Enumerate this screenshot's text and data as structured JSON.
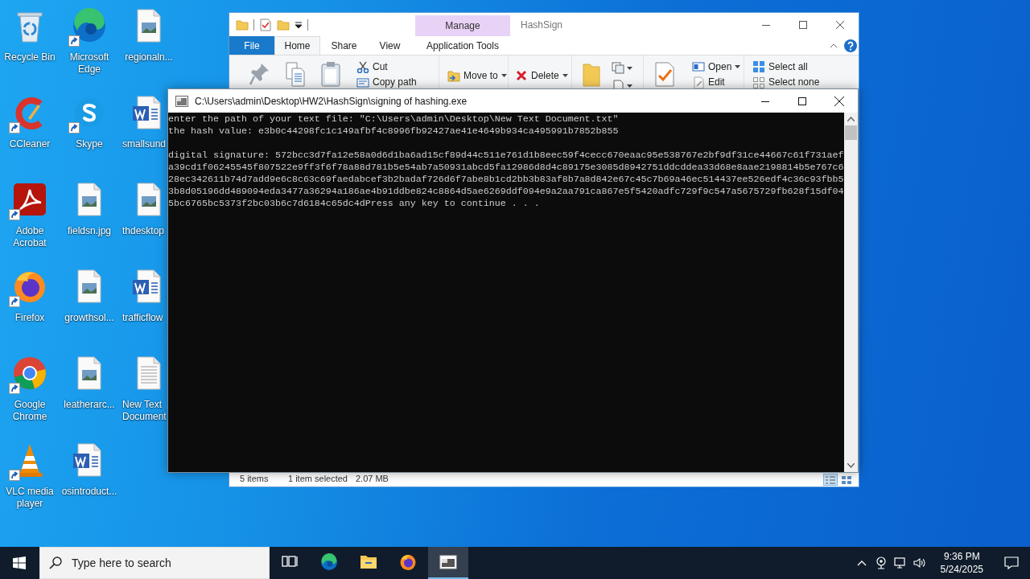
{
  "desktop_icons": [
    {
      "label": "Recycle Bin",
      "kind": "recycle",
      "shortcut": false,
      "cut": false
    },
    {
      "label": "CCleaner",
      "kind": "ccleaner",
      "shortcut": true,
      "cut": false
    },
    {
      "label": "Adobe Acrobat",
      "kind": "acrobat",
      "shortcut": true,
      "cut": false
    },
    {
      "label": "Firefox",
      "kind": "firefox",
      "shortcut": true,
      "cut": false
    },
    {
      "label": "Google Chrome",
      "kind": "chrome",
      "shortcut": true,
      "cut": false
    },
    {
      "label": "VLC media player",
      "kind": "vlc",
      "shortcut": true,
      "cut": false
    },
    {
      "label": "Microsoft Edge",
      "kind": "edge",
      "shortcut": true,
      "cut": false
    },
    {
      "label": "Skype",
      "kind": "skype",
      "shortcut": true,
      "cut": false
    },
    {
      "label": "fieldsn.jpg",
      "kind": "image",
      "shortcut": false,
      "cut": false
    },
    {
      "label": "growthsol...",
      "kind": "image",
      "shortcut": false,
      "cut": false
    },
    {
      "label": "leatherarc...",
      "kind": "image",
      "shortcut": false,
      "cut": false
    },
    {
      "label": "osintroduct...",
      "kind": "word",
      "shortcut": false,
      "cut": false
    },
    {
      "label": "regionaln...",
      "kind": "image",
      "shortcut": false,
      "cut": false
    },
    {
      "label": "smallsund",
      "kind": "word",
      "shortcut": false,
      "cut": true
    },
    {
      "label": "thdesktop",
      "kind": "image",
      "shortcut": false,
      "cut": true
    },
    {
      "label": "trafficflow",
      "kind": "word",
      "shortcut": false,
      "cut": true
    },
    {
      "label": "New Text Document",
      "kind": "text",
      "shortcut": false,
      "cut": true
    }
  ],
  "explorer": {
    "title": "HashSign",
    "context_group": "Manage",
    "tabs": [
      {
        "label": "File",
        "kind": "file",
        "selected": false
      },
      {
        "label": "Home",
        "kind": "tab",
        "selected": true
      },
      {
        "label": "Share",
        "kind": "tab",
        "selected": false
      },
      {
        "label": "View",
        "kind": "tab",
        "selected": false
      },
      {
        "label": "Application Tools",
        "kind": "context",
        "selected": false
      }
    ],
    "ribbon": [
      {
        "label": "Cut",
        "kind": "cut",
        "dropdown": false
      },
      {
        "label": "Copy path",
        "kind": "copy-path",
        "dropdown": false
      },
      {
        "label": "Move to",
        "kind": "move-to",
        "dropdown": true
      },
      {
        "label": "Delete",
        "kind": "delete",
        "dropdown": true
      },
      {
        "label": "Open",
        "kind": "open",
        "dropdown": true
      },
      {
        "label": "Edit",
        "kind": "edit",
        "dropdown": false
      },
      {
        "label": "Select all",
        "kind": "select-all",
        "dropdown": false
      },
      {
        "label": "Select none",
        "kind": "select-none",
        "dropdown": false
      }
    ],
    "status": {
      "items": "5 items",
      "selection": "1 item selected",
      "size": "2.07 MB"
    }
  },
  "console": {
    "title": "C:\\Users\\admin\\Desktop\\HW2\\HashSign\\signing of hashing.exe",
    "blocks": [
      [
        "enter the path of your text file: \"C:\\Users\\admin\\Desktop\\New Text Document.txt\"",
        "the hash value: e3b0c44298fc1c149afbf4c8996fb92427ae41e4649b934ca495991b7852b855"
      ],
      [
        "digital signature: 572bcc3d7fa12e58a0d6d1ba6ad15cf89d44c511e761d1b8eec59f4cecc670eaac95e538767e2bf9df31ce44667c61f731aef",
        "a39cd1f06245545f807522e9ff3f6f78a88d781b5e54ab7a50931abcd5fa12986d8d4c89175e3085d8942751ddcddea33d68e8aae2198814b5e767c6",
        "28ec342611b74d7add9e6c8c63c69faedabcef3b2badaf726d6f7abe8b1cd2bb3b83af8b7a8d842e67c45c7b69a46ec514437ee526edf4c36c93fbb5",
        "3b8d05196dd489094eda3477a36294a186ae4b91ddbe824c8864d5ae6269ddf094e9a2aa791ca867e5f5420adfc729f9c547a5675729fb628f15df04",
        "5bc6765bc5373f2bc03b6c7d6184c65dc4dPress any key to continue . . ."
      ]
    ]
  },
  "taskbar": {
    "search_placeholder": "Type here to search",
    "apps": [
      {
        "kind": "task-view",
        "selected": false
      },
      {
        "kind": "edge",
        "selected": false
      },
      {
        "kind": "explorer",
        "selected": false
      },
      {
        "kind": "firefox",
        "selected": false
      },
      {
        "kind": "console",
        "selected": true
      }
    ],
    "time": "9:36 PM",
    "date": "5/24/2025"
  }
}
